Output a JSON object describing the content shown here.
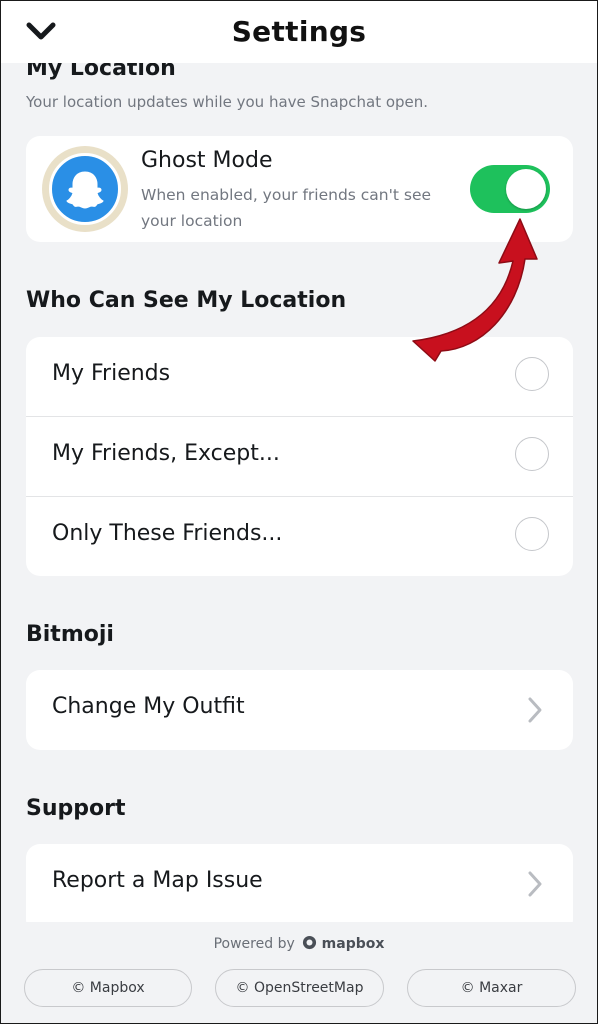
{
  "header": {
    "title": "Settings"
  },
  "my_location": {
    "title": "My Location",
    "subtitle": "Your location updates while you have Snapchat open.",
    "ghost_mode": {
      "label": "Ghost Mode",
      "description": "When enabled, your friends can't see your location",
      "enabled": true
    }
  },
  "who_can_see": {
    "title": "Who Can See My Location",
    "options": [
      {
        "label": "My Friends",
        "selected": false
      },
      {
        "label": "My Friends, Except...",
        "selected": false
      },
      {
        "label": "Only These Friends...",
        "selected": false
      }
    ]
  },
  "bitmoji": {
    "title": "Bitmoji",
    "item": "Change My Outfit"
  },
  "support": {
    "title": "Support",
    "item": "Report a Map Issue"
  },
  "footer": {
    "powered_by": "Powered by",
    "brand": "mapbox",
    "attributions": [
      "© Mapbox",
      "© OpenStreetMap",
      "© Maxar"
    ]
  },
  "colors": {
    "toggle_on": "#1ec15c",
    "avatar_blue": "#2a8fe6",
    "annotation_arrow": "#c8101e"
  },
  "icons": {
    "back": "chevron-down-icon",
    "row_nav": "chevron-right-icon",
    "avatar": "snapchat-ghost-icon",
    "mapbox_logo": "mapbox-logo-icon"
  }
}
